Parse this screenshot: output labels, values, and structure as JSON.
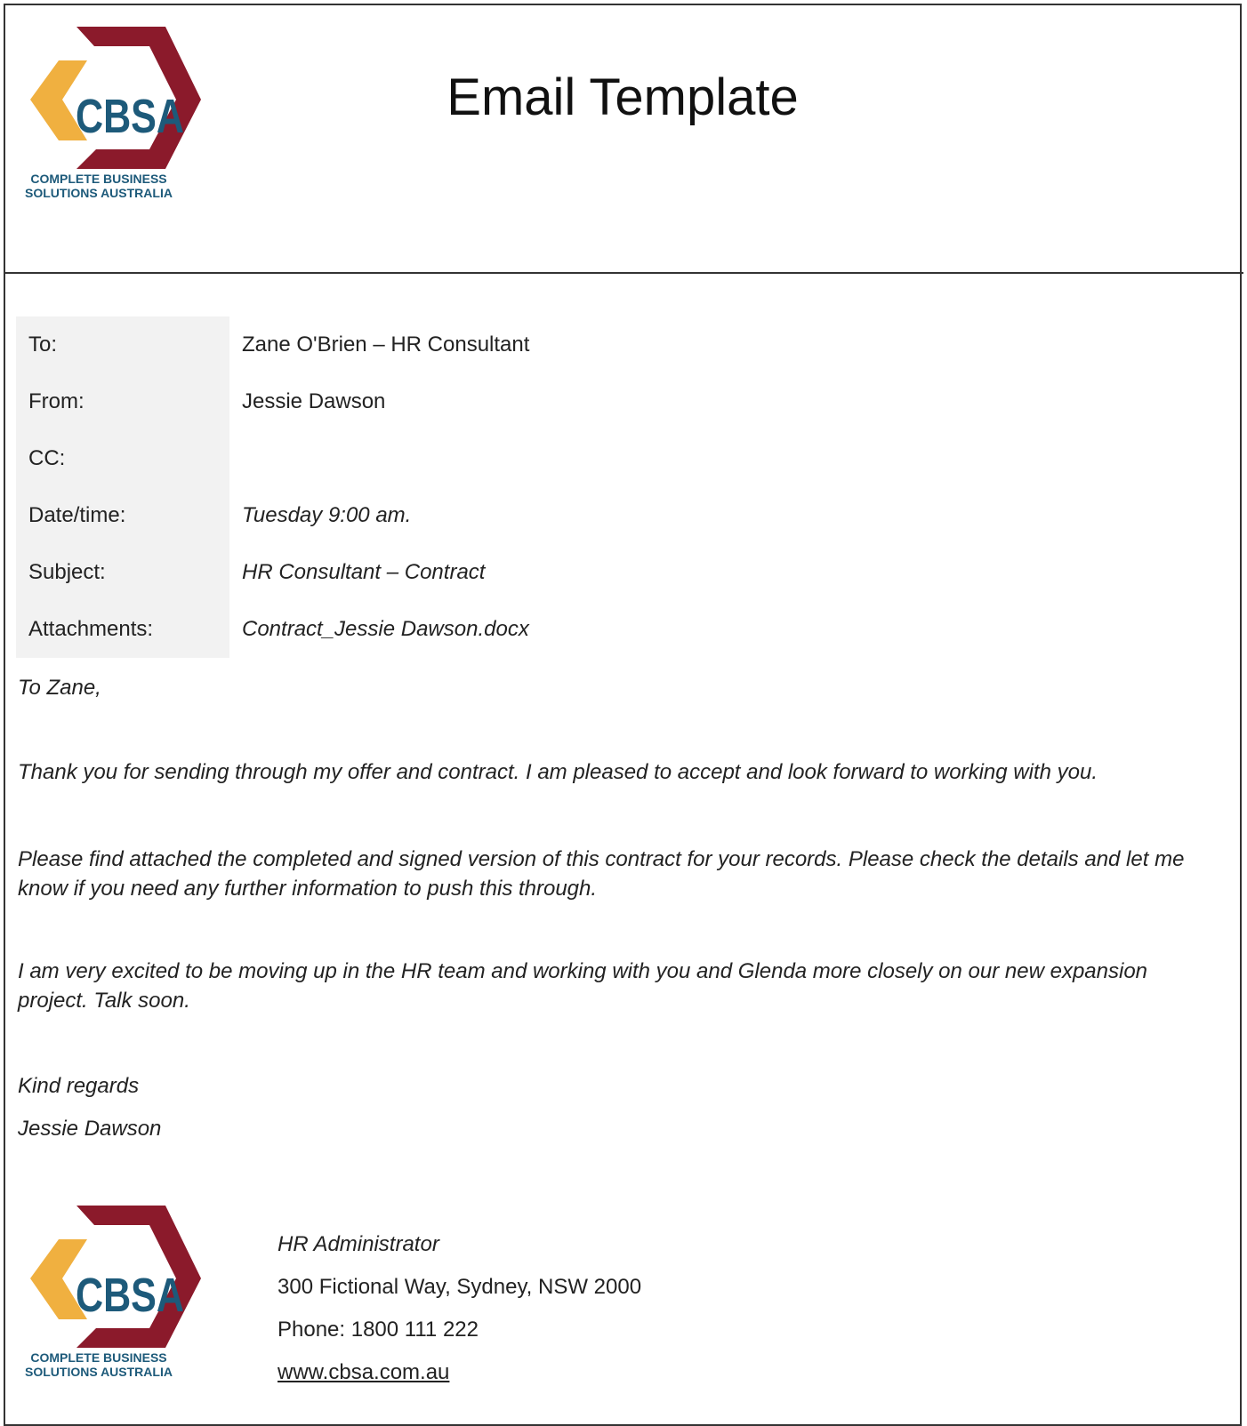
{
  "title": "Email Template",
  "logo": {
    "brand_text": "CBSA",
    "tagline_line1": "COMPLETE BUSINESS",
    "tagline_line2": "SOLUTIONS AUSTRALIA",
    "colors": {
      "maroon": "#8b1a2b",
      "gold": "#f0b040",
      "blue": "#1d5a7a"
    }
  },
  "header_fields": [
    {
      "label": "To:",
      "value": "Zane O'Brien – HR Consultant"
    },
    {
      "label": "From:",
      "value": "Jessie Dawson"
    },
    {
      "label": "CC:",
      "value": ""
    },
    {
      "label": "Date/time:",
      "value": "Tuesday 9:00 am."
    },
    {
      "label": "Subject:",
      "value": "HR Consultant – Contract"
    },
    {
      "label": "Attachments:",
      "value": "Contract_Jessie Dawson.docx"
    }
  ],
  "body": {
    "greeting": "To Zane,",
    "paragraph1": "Thank you for sending through my offer and contract. I am pleased to accept and look forward to working with you.",
    "paragraph2": "Please find attached the completed and signed version of this contract for your records. Please check the details and let me know if you need any further information to push this through.",
    "paragraph3": "I am very excited to be moving up in the HR team and working with you and Glenda more closely on our new expansion project. Talk soon.",
    "closing": "Kind regards",
    "signature_name": "Jessie Dawson"
  },
  "signature": {
    "role": "HR Administrator",
    "address": "300 Fictional Way, Sydney, NSW 2000",
    "phone": "Phone: 1800 111 222",
    "website": "www.cbsa.com.au"
  }
}
